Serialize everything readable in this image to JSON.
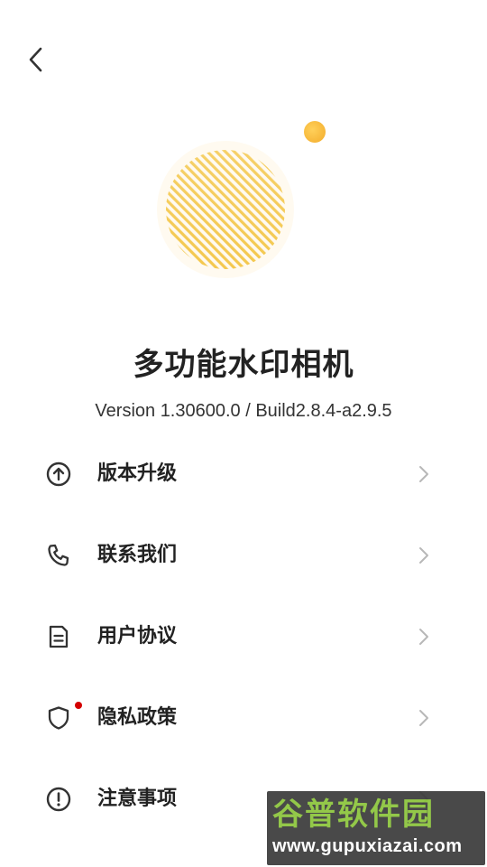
{
  "header": {
    "back_icon": "chevron-left-icon"
  },
  "app": {
    "name": "多功能水印相机",
    "version": "Version 1.30600.0 / Build2.8.4-a2.9.5"
  },
  "menu": {
    "items": [
      {
        "label": "版本升级",
        "icon": "arrow-up-circle-icon"
      },
      {
        "label": "联系我们",
        "icon": "phone-icon"
      },
      {
        "label": "用户协议",
        "icon": "document-icon"
      },
      {
        "label": "隐私政策",
        "icon": "shield-icon",
        "badge": true
      },
      {
        "label": "注意事项",
        "icon": "exclamation-circle-icon"
      }
    ]
  },
  "watermark": {
    "text": "谷普软件园",
    "url": "www.gupuxiazai.com"
  },
  "colors": {
    "accent_yellow": "#f5c842",
    "badge_red": "#d40000",
    "watermark_green": "#8ac43a"
  }
}
